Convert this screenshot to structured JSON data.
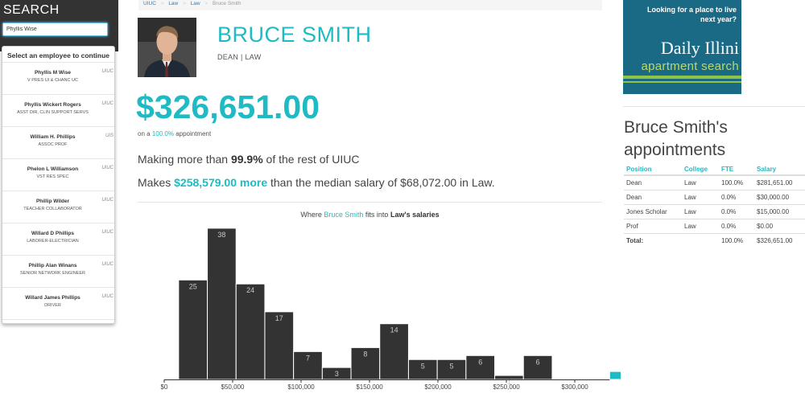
{
  "search": {
    "title": "SEARCH",
    "value": "Phyllis Wise",
    "dropdown_header": "Select an employee to continue",
    "results": [
      {
        "name": "Phyllis M Wise",
        "title": "V PRES UI & CHANC UC",
        "tag": "UIUC"
      },
      {
        "name": "Phyllis Wickert Rogers",
        "title": "ASST DIR, CLIN SUPPORT SERVS",
        "tag": "UIUC"
      },
      {
        "name": "William H. Phillips",
        "title": "ASSOC PROF",
        "tag": "UIS"
      },
      {
        "name": "Phelon L Williamson",
        "title": "VST RES SPEC",
        "tag": "UIUC"
      },
      {
        "name": "Phillip Wilder",
        "title": "TEACHER COLLABORATOR",
        "tag": "UIUC"
      },
      {
        "name": "Willard D Phillips",
        "title": "LABORER-ELECTRICIAN",
        "tag": "UIUC"
      },
      {
        "name": "Phillip Alan Winans",
        "title": "SENIOR NETWORK ENGINEER",
        "tag": "UIUC"
      },
      {
        "name": "Willard James Phillips",
        "title": "DRIVER",
        "tag": "UIUC"
      }
    ]
  },
  "breadcrumb": {
    "items": [
      "UIUC",
      "Law",
      "Law"
    ],
    "current": "Bruce Smith",
    "separator": ">"
  },
  "profile": {
    "name": "BRUCE SMITH",
    "role": "DEAN | LAW",
    "salary": "$326,651.00",
    "appt_prefix": "on a",
    "appt_pct": "100.0%",
    "appt_suffix": "appointment",
    "stat1_prefix": "Making more than",
    "stat1_pct": "99.9%",
    "stat1_suffix": "of the rest of UIUC",
    "stat2_prefix": "Makes",
    "stat2_amount": "$258,579.00 more",
    "stat2_suffix": "than the median salary of $68,072.00 in Law."
  },
  "chart_caption": {
    "prefix": "Where",
    "name": "Bruce Smith",
    "middle": "fits into",
    "dept": "Law's salaries"
  },
  "chart_data": {
    "type": "bar",
    "title": "Where Bruce Smith fits into Law's salaries",
    "bin_width": 21000,
    "x_start": 0,
    "bin_starts": [
      10500,
      31500,
      52500,
      73500,
      94500,
      115500,
      136500,
      157500,
      178500,
      199500,
      220500,
      241500,
      262500,
      283500,
      304500,
      325500
    ],
    "values": [
      25,
      38,
      24,
      17,
      7,
      3,
      8,
      14,
      5,
      5,
      6,
      1,
      6,
      0,
      0,
      2
    ],
    "highlight_index": 15,
    "xlim": [
      0,
      325500
    ],
    "xticks": [
      0,
      50000,
      100000,
      150000,
      200000,
      250000,
      300000
    ],
    "xtick_labels": [
      "$0",
      "$50,000",
      "$100,000",
      "$150,000",
      "$200,000",
      "$250,000",
      "$300,000"
    ],
    "ylim": [
      0,
      38
    ],
    "colors": {
      "bar": "#333333",
      "highlight": "#1ebbc4",
      "label": "#c8c8c8"
    }
  },
  "ad": {
    "headline": "Looking for a place to live next year?",
    "brand": "Daily Illini",
    "tagline": "apartment search",
    "bg_color": "#1b6a85",
    "accent_color": "#8fc447"
  },
  "appointments": {
    "title": "Bruce Smith's appointments",
    "headers": [
      "Position",
      "College",
      "FTE",
      "Salary"
    ],
    "rows": [
      [
        "Dean",
        "Law",
        "100.0%",
        "$281,651.00"
      ],
      [
        "Dean",
        "Law",
        "0.0%",
        "$30,000.00"
      ],
      [
        "Jones Scholar",
        "Law",
        "0.0%",
        "$15,000.00"
      ],
      [
        "Prof",
        "Law",
        "0.0%",
        "$0.00"
      ]
    ],
    "total": [
      "Total:",
      "",
      "100.0%",
      "$326,651.00"
    ]
  },
  "colors": {
    "accent": "#1ebbc4",
    "sidebar_bg": "#333333"
  }
}
